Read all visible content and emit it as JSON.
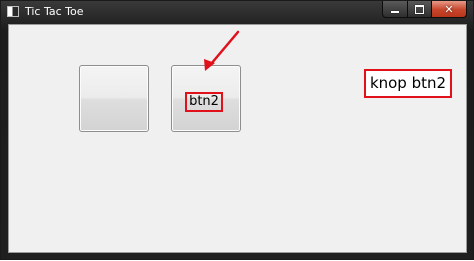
{
  "window": {
    "title": "Tic Tac Toe",
    "icon": "app-window-icon",
    "controls": {
      "minimize_icon": "minimize-icon",
      "maximize_icon": "maximize-icon",
      "close_icon": "close-icon",
      "close_glyph": "✕"
    }
  },
  "board": {
    "buttons": [
      {
        "label": ""
      },
      {
        "label": "btn2"
      }
    ]
  },
  "annotation": {
    "text": "knop btn2",
    "highlight_color": "#e0111b",
    "arrow_icon": "arrow-icon"
  }
}
